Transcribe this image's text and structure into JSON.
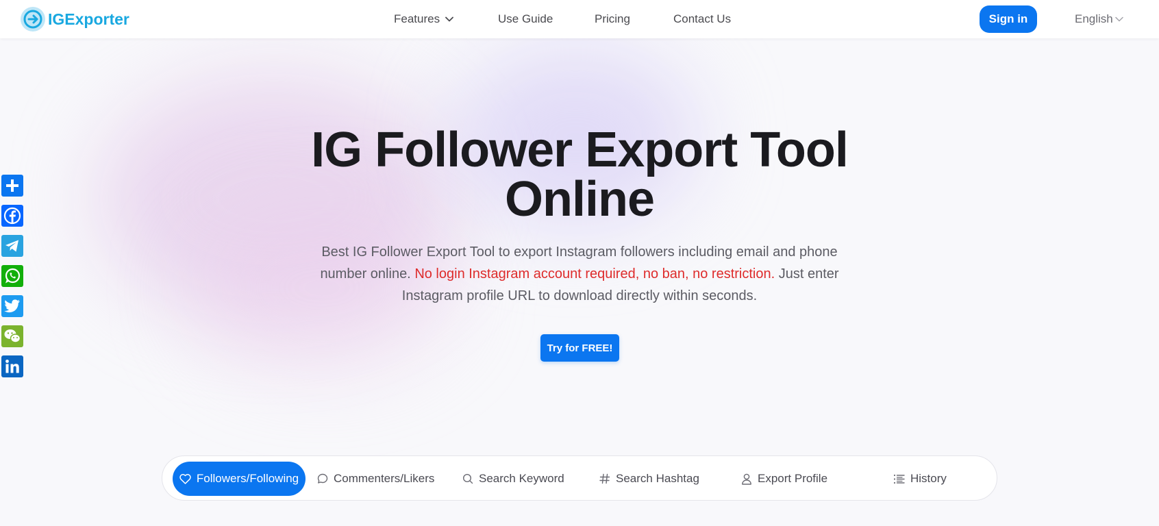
{
  "header": {
    "logo_text": "IGExporter",
    "logo_icon": "arrow-circle-icon",
    "nav": {
      "features": "Features",
      "use_guide": "Use Guide",
      "pricing": "Pricing",
      "contact": "Contact Us"
    },
    "signin_label": "Sign in",
    "language": "English"
  },
  "share_bar": [
    "share-plus",
    "facebook",
    "telegram",
    "whatsapp",
    "twitter",
    "wechat",
    "linkedin"
  ],
  "hero": {
    "title_line1": "IG Follower Export Tool",
    "title_line2": "Online",
    "desc_part1": "Best IG Follower Export Tool to export Instagram followers including email and phone number online.",
    "desc_highlight": "No login Instagram account required, no ban, no restriction.",
    "desc_part2": "Just enter Instagram profile URL to download directly within seconds.",
    "cta_label": "Try for FREE!"
  },
  "tabs": {
    "followers": "Followers/Following",
    "commenters": "Commenters/Likers",
    "keyword": "Search Keyword",
    "hashtag": "Search Hashtag",
    "profile": "Export Profile",
    "history": "History"
  },
  "colors": {
    "primary": "#0b76f0",
    "logo": "#19a8e0",
    "highlight": "#de2b2b",
    "facebook": "#0866ff",
    "telegram": "#2aa3e0",
    "whatsapp": "#12af0a",
    "twitter": "#1d9bf0",
    "wechat": "#7bb32e",
    "linkedin": "#0a66c2"
  }
}
